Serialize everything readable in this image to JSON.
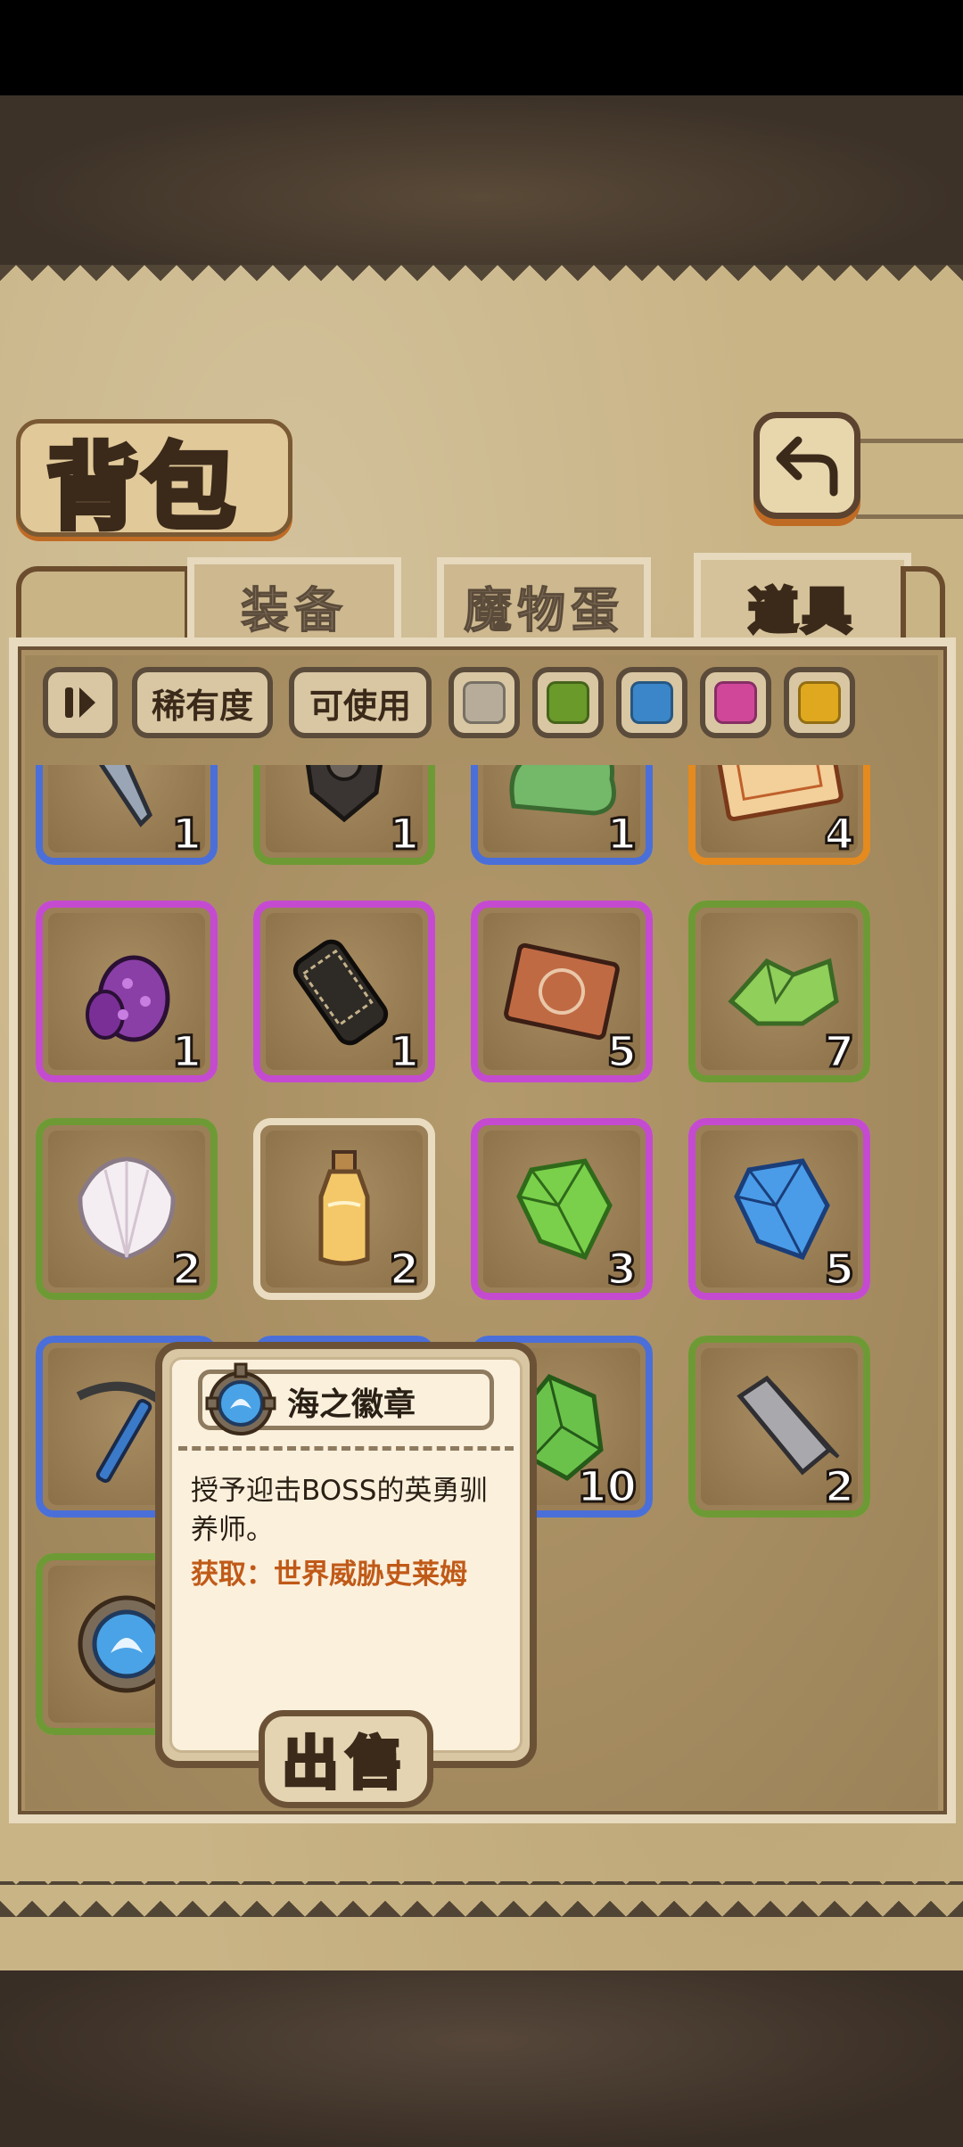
{
  "header": {
    "title": "背包"
  },
  "tabs": [
    {
      "label": "装备",
      "active": false
    },
    {
      "label": "魔物蛋",
      "active": false
    },
    {
      "label": "道具",
      "active": true
    }
  ],
  "filters": {
    "sort_icon": "sort-icon",
    "rarity_label": "稀有度",
    "usable_label": "可使用",
    "rarity_colors": [
      "#b7ac9a",
      "#6a9a2a",
      "#3b86c8",
      "#d0479a",
      "#e0a81e"
    ]
  },
  "rarity_border": {
    "green": "#6e9a35",
    "blue": "#4a6fd8",
    "purple": "#c44bd0",
    "orange": "#e48a1e",
    "white": "#e9dcc0"
  },
  "items": [
    {
      "name": "dagger",
      "rarity": "blue",
      "qty": "1"
    },
    {
      "name": "dark-crest",
      "rarity": "green",
      "qty": "1"
    },
    {
      "name": "green-slime",
      "rarity": "blue",
      "qty": "1"
    },
    {
      "name": "ticket",
      "rarity": "orange",
      "qty": "4"
    },
    {
      "name": "purple-egg",
      "rarity": "purple",
      "qty": "1"
    },
    {
      "name": "cage-cylinder",
      "rarity": "purple",
      "qty": "1"
    },
    {
      "name": "rune-card",
      "rarity": "purple",
      "qty": "5"
    },
    {
      "name": "green-crystals",
      "rarity": "green",
      "qty": "7"
    },
    {
      "name": "shell",
      "rarity": "green",
      "qty": "2"
    },
    {
      "name": "potion-bottle",
      "rarity": "white",
      "qty": "2"
    },
    {
      "name": "green-gem",
      "rarity": "purple",
      "qty": "3"
    },
    {
      "name": "blue-gem",
      "rarity": "purple",
      "qty": "5"
    },
    {
      "name": "pickaxe",
      "rarity": "blue",
      "qty": ""
    },
    {
      "name": "hidden-item",
      "rarity": "blue",
      "qty": ""
    },
    {
      "name": "emerald-shard",
      "rarity": "blue",
      "qty": "10"
    },
    {
      "name": "iron-bar",
      "rarity": "green",
      "qty": "2"
    },
    {
      "name": "sea-badge",
      "rarity": "green",
      "qty": ""
    }
  ],
  "tooltip": {
    "name": "海之徽章",
    "description": "授予迎击BOSS的英勇驯养师。",
    "source": "获取：世界威胁史莱姆",
    "sell_label": "出售"
  }
}
